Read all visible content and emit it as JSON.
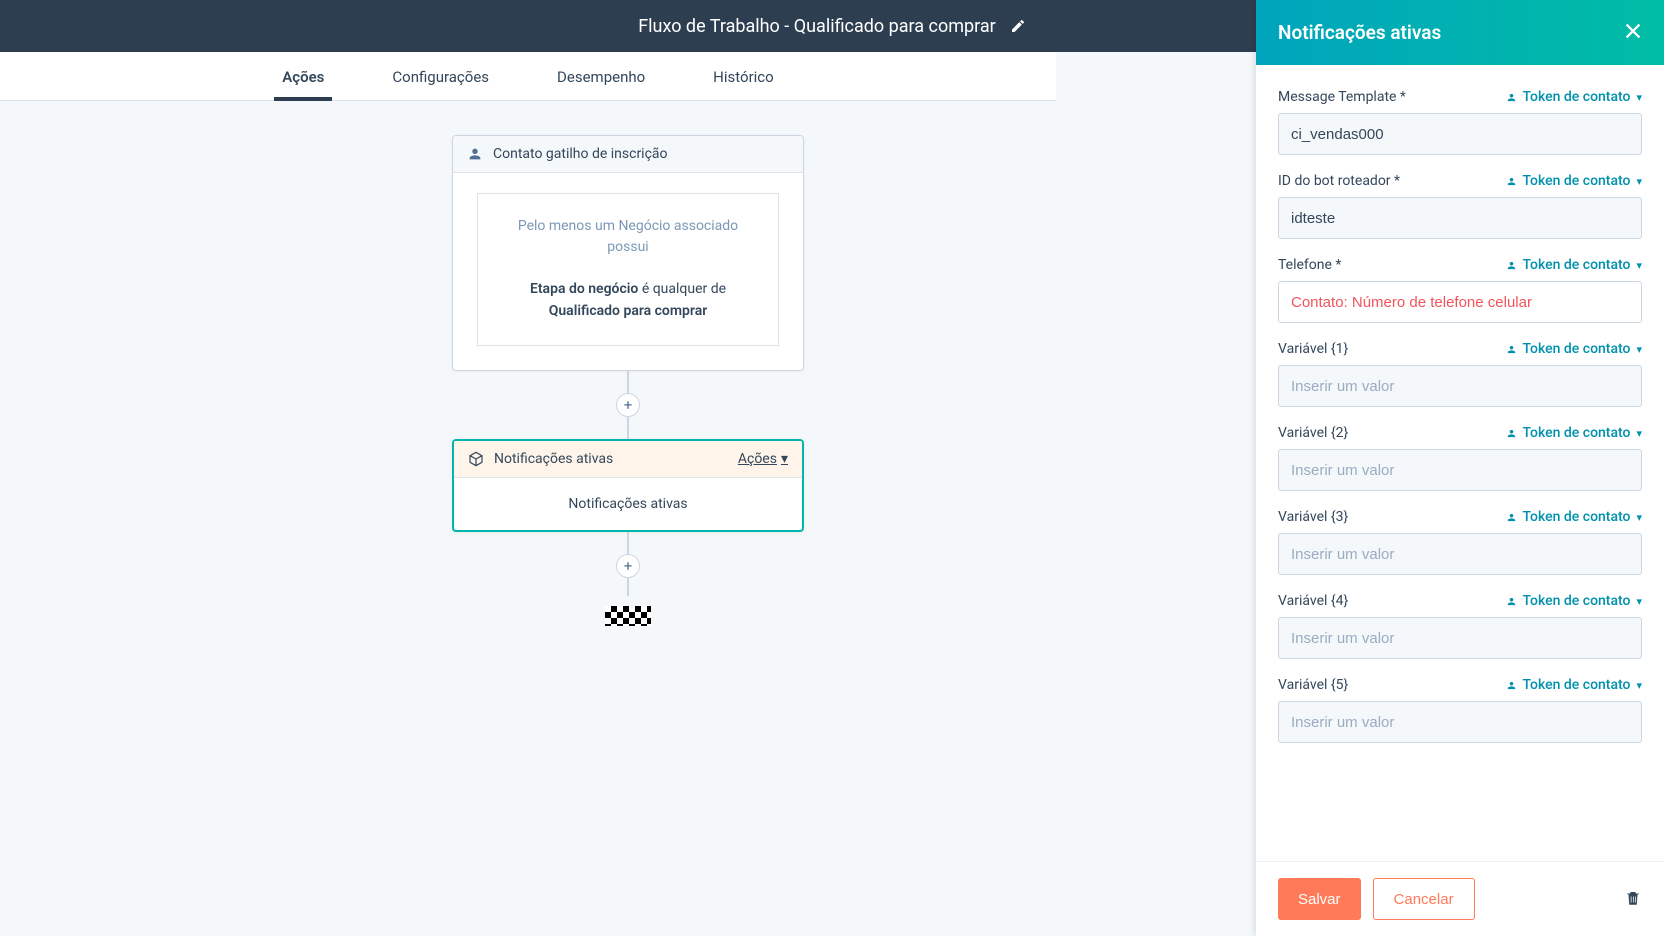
{
  "topbar": {
    "title": "Fluxo de Trabalho - Qualificado para comprar"
  },
  "tabs": {
    "t0": "Ações",
    "t1": "Configurações",
    "t2": "Desempenho",
    "t3": "Histórico"
  },
  "trigger": {
    "head": "Contato gatilho de inscrição",
    "line1": "Pelo menos um Negócio associado possui",
    "line2_bold1": "Etapa do negócio",
    "line2_mid": " é qualquer de ",
    "line2_bold2": "Qualificado para comprar"
  },
  "action_node": {
    "head": "Notificações ativas",
    "menu": "Ações",
    "body": "Notificações ativas"
  },
  "panel": {
    "title": "Notificações ativas",
    "token_label": "Token de contato",
    "fields": [
      {
        "label": "Message Template *",
        "value": "ci_vendas000",
        "placeholder": "",
        "token": false
      },
      {
        "label": "ID do bot roteador *",
        "value": "idteste",
        "placeholder": "",
        "token": false
      },
      {
        "label": "Telefone *",
        "value": "Contato: Número de telefone celular",
        "placeholder": "",
        "token": true
      },
      {
        "label": "Variável {1}",
        "value": "",
        "placeholder": "Inserir um valor",
        "token": false
      },
      {
        "label": "Variável {2}",
        "value": "",
        "placeholder": "Inserir um valor",
        "token": false
      },
      {
        "label": "Variável {3}",
        "value": "",
        "placeholder": "Inserir um valor",
        "token": false
      },
      {
        "label": "Variável {4}",
        "value": "",
        "placeholder": "Inserir um valor",
        "token": false
      },
      {
        "label": "Variável {5}",
        "value": "",
        "placeholder": "Inserir um valor",
        "token": false
      }
    ],
    "save": "Salvar",
    "cancel": "Cancelar"
  }
}
